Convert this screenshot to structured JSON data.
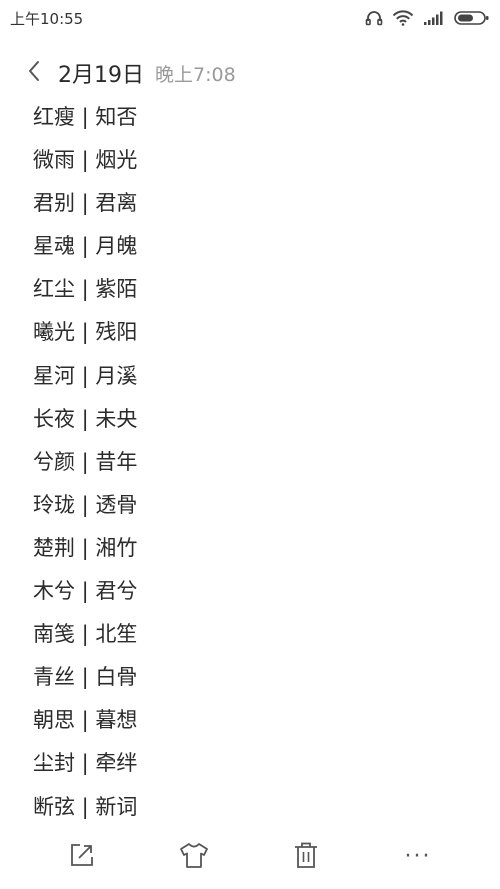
{
  "status_bar": {
    "time": "上午10:55",
    "icons": [
      "headphones-icon",
      "wifi-icon",
      "signal-icon",
      "battery-icon"
    ]
  },
  "header": {
    "back_icon": "chevron-left-icon",
    "date": "2月19日",
    "time": "晚上7:08"
  },
  "note": {
    "lines": [
      "红瘦 | 知否",
      "微雨 | 烟光",
      "君别 | 君离",
      "星魂 | 月魄",
      "红尘 | 紫陌",
      "曦光 | 残阳",
      "星河 | 月溪",
      "长夜 | 未央",
      "兮颜 | 昔年",
      "玲珑 | 透骨",
      "楚荆 | 湘竹",
      "木兮 | 君兮",
      "南笺 | 北笙",
      "青丝 | 白骨",
      "朝思 | 暮想",
      "尘封 | 牵绊",
      "断弦 | 新词"
    ]
  },
  "toolbar": {
    "items": [
      "share-icon",
      "theme-icon",
      "delete-icon",
      "more-icon"
    ],
    "more_label": "···"
  },
  "colors": {
    "text": "#2b2b2b",
    "secondary": "#9a9a9a",
    "icon": "#555555"
  }
}
